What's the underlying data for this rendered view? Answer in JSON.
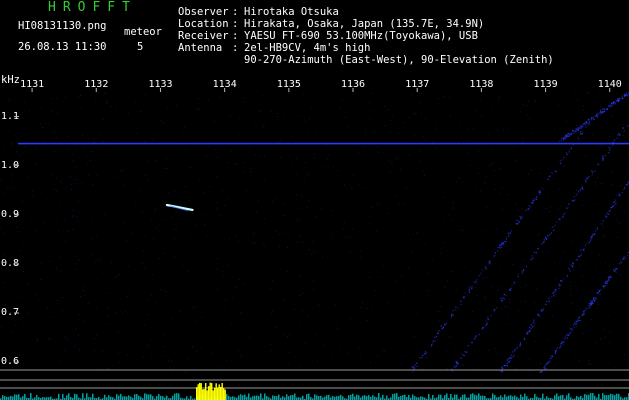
{
  "header": {
    "app_title": "HROFFT",
    "filename": "HI08131130.png",
    "datetime": "26.08.13 11:30",
    "meteor_label": "meteor",
    "meteor_count": "5"
  },
  "info": {
    "observer": {
      "key": "Observer",
      "value": "Hirotaka Otsuka"
    },
    "location": {
      "key": "Location",
      "value": "Hirakata, Osaka, Japan (135.7E, 34.9N)"
    },
    "receiver": {
      "key": "Receiver",
      "value": "YAESU FT-690 53.100MHz(Toyokawa), USB"
    },
    "antenna": {
      "key": "Antenna",
      "value": "2el-HB9CV, 4m's high"
    },
    "antenna_line2": "90-270-Azimuth (East-West), 90-Elevation (Zenith)"
  },
  "chart_data": {
    "type": "heatmap",
    "ylabel": "kHz",
    "y_ticks": [
      "1.1",
      "1.0",
      "0.9",
      "0.8",
      "0.7",
      "0.6"
    ],
    "x_ticks": [
      "1131",
      "1132",
      "1133",
      "1134",
      "1135",
      "1136",
      "1137",
      "1138",
      "1139",
      "1140"
    ],
    "ylim": [
      0.58,
      1.15
    ],
    "xlim": [
      1130.5,
      1140.3
    ],
    "carrier_khz": 1.045,
    "meteor_echo": {
      "time_start": 1133.1,
      "time_end": 1133.5,
      "khz_start": 0.92,
      "khz_end": 0.91
    }
  },
  "colors": {
    "background": "#000000",
    "title": "#33cc33",
    "text": "#ffffff",
    "signal": "#2a3cff",
    "echo": "#ccffff",
    "audio": "#ffff00",
    "audio_base": "#00cccc"
  }
}
